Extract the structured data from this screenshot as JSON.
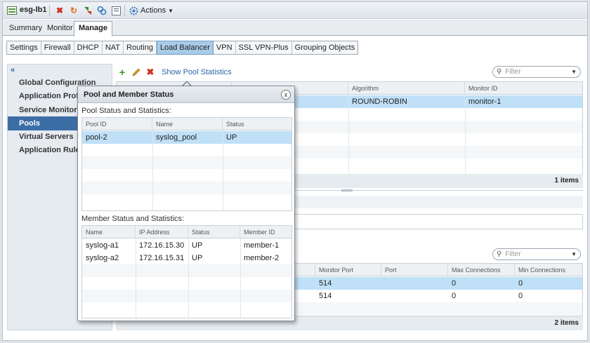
{
  "window": {
    "edge_name": "esg-lb1",
    "actions_label": "Actions",
    "toolbar_icons": [
      "edge-icon",
      "delete-icon",
      "refresh-icon",
      "deploy-icon",
      "sync-icon",
      "details-icon",
      "gear-icon"
    ]
  },
  "main_tabs": [
    {
      "label": "Summary",
      "active": false
    },
    {
      "label": "Monitor",
      "active": false
    },
    {
      "label": "Manage",
      "active": true
    }
  ],
  "sub_tabs": [
    {
      "label": "Settings",
      "active": false
    },
    {
      "label": "Firewall",
      "active": false
    },
    {
      "label": "DHCP",
      "active": false
    },
    {
      "label": "NAT",
      "active": false
    },
    {
      "label": "Routing",
      "active": false
    },
    {
      "label": "Load Balancer",
      "active": true
    },
    {
      "label": "VPN",
      "active": false
    },
    {
      "label": "SSL VPN-Plus",
      "active": false
    },
    {
      "label": "Grouping Objects",
      "active": false
    }
  ],
  "leftnav": {
    "collapse_glyph": "«",
    "items": [
      {
        "label": "Global Configuration",
        "active": false
      },
      {
        "label": "Application Profiles",
        "active": false
      },
      {
        "label": "Service Monitoring",
        "active": false
      },
      {
        "label": "Pools",
        "active": true
      },
      {
        "label": "Virtual Servers",
        "active": false
      },
      {
        "label": "Application Rules",
        "active": false
      }
    ]
  },
  "pools_panel": {
    "show_stats_label": "Show Pool Statistics",
    "filter_placeholder": "Filter",
    "columns": [
      "Pool ID",
      "Name",
      "Algorithm",
      "Monitor ID"
    ],
    "rows": [
      {
        "pool_id": "",
        "name": "",
        "algorithm": "ROUND-ROBIN",
        "monitor_id": "monitor-1"
      }
    ],
    "count": "1 items"
  },
  "members_panel": {
    "filter_placeholder": "Filter",
    "columns": [
      "Monitor Port",
      "Port",
      "Max Connections",
      "Min Connections"
    ],
    "rows": [
      {
        "monitor_port": "514",
        "port": "",
        "max_conn": "0",
        "min_conn": "0"
      },
      {
        "monitor_port": "514",
        "port": "",
        "max_conn": "0",
        "min_conn": "0"
      }
    ],
    "count": "2 items"
  },
  "dialog": {
    "title": "Pool and Member Status",
    "close_glyph": "x",
    "pool_caption": "Pool Status and Statistics:",
    "pool_columns": [
      "Pool ID",
      "Name",
      "Status"
    ],
    "pool_rows": [
      {
        "pool_id": "pool-2",
        "name": "syslog_pool",
        "status": "UP"
      }
    ],
    "member_caption": "Member Status and Statistics:",
    "member_columns": [
      "Name",
      "IP Address",
      "Status",
      "Member ID"
    ],
    "member_rows": [
      {
        "name": "syslog-a1",
        "ip": "172.16.15.30",
        "status": "UP",
        "member_id": "member-1"
      },
      {
        "name": "syslog-a2",
        "ip": "172.16.15.31",
        "status": "UP",
        "member_id": "member-2"
      }
    ]
  },
  "colors": {
    "accent": "#3c6ea6",
    "selected_row": "#bfe0f7",
    "active_subtab": "#a9cbe8",
    "link": "#2a65a8"
  }
}
